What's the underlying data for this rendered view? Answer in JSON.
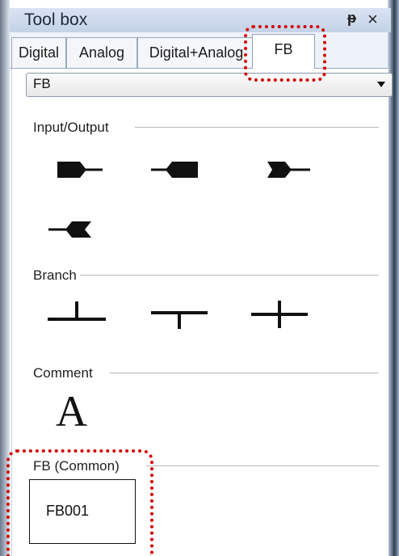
{
  "window": {
    "title": "Tool box",
    "pin_label": "ᵽ",
    "close_label": "×"
  },
  "tabs": [
    {
      "label": "Digital"
    },
    {
      "label": "Analog"
    },
    {
      "label": "Digital+Analog"
    },
    {
      "label": "FB"
    }
  ],
  "dropdown": {
    "selected": "FB"
  },
  "sections": {
    "input_output": "Input/Output",
    "branch": "Branch",
    "comment": "Comment",
    "fb_common": "FB (Common)"
  },
  "fb_item": {
    "label": "FB001"
  },
  "comment_glyph": "A"
}
